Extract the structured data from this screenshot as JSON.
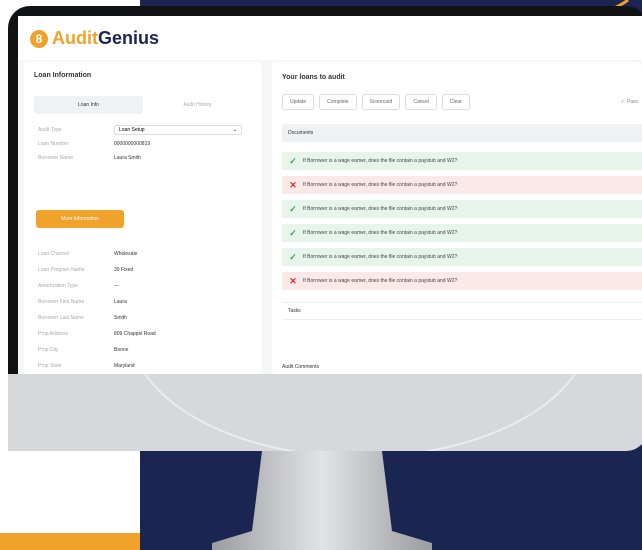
{
  "colors": {
    "navy": "#1b2551",
    "orange": "#f0a22a",
    "pass_bg": "#e6f4ea",
    "fail_bg": "#fbe9e9"
  },
  "app": {
    "logo_mark": "8",
    "logo_audit": "Audit",
    "logo_genius": "Genius"
  },
  "left": {
    "title": "Loan Information",
    "tabs": [
      "Loan Info",
      "Audit History"
    ],
    "fields_top": [
      {
        "label": "Audit Type",
        "value": "Loan Setup"
      },
      {
        "label": "Loan Number",
        "value": "0000000000819"
      },
      {
        "label": "Borrower Name",
        "value": "Laura Smith"
      }
    ],
    "more_button": "More Information",
    "fields_bottom": [
      {
        "label": "Loan Channel",
        "value": "Wholesale"
      },
      {
        "label": "Loan Program Name",
        "value": "30 Fixed"
      },
      {
        "label": "Amortization Type",
        "value": "—"
      },
      {
        "label": "Borrower First Name",
        "value": "Laura"
      },
      {
        "label": "Borrower Last Name",
        "value": "Smith"
      },
      {
        "label": "Prop Address",
        "value": "809 Chappel Road"
      },
      {
        "label": "Prop City",
        "value": "Boone"
      },
      {
        "label": "Prop State",
        "value": "Maryland"
      }
    ]
  },
  "right": {
    "title": "Your loans to audit",
    "toolbar": [
      "Update",
      "Complete",
      "Scorecard",
      "Cancel",
      "Clear"
    ],
    "pass_label": "Pass",
    "documents_label": "Documents",
    "checks": [
      {
        "status": "pass",
        "text": "If Borrower is a wage earner, does the file contain a paystub and W2?"
      },
      {
        "status": "fail",
        "text": "If Borrower is a wage earner, does the file contain a paystub and W2?"
      },
      {
        "status": "pass",
        "text": "If Borrower is a wage earner, does the file contain a paystub and W2?"
      },
      {
        "status": "pass",
        "text": "If Borrower is a wage earner, does the file contain a paystub and W2?"
      },
      {
        "status": "pass",
        "text": "If Borrower is a wage earner, does the file contain a paystub and W2?"
      },
      {
        "status": "fail",
        "text": "If Borrower is a wage earner, does the file contain a paystub and W2?"
      }
    ],
    "tasks_label": "Tasks",
    "comments_label": "Audit Comments"
  }
}
